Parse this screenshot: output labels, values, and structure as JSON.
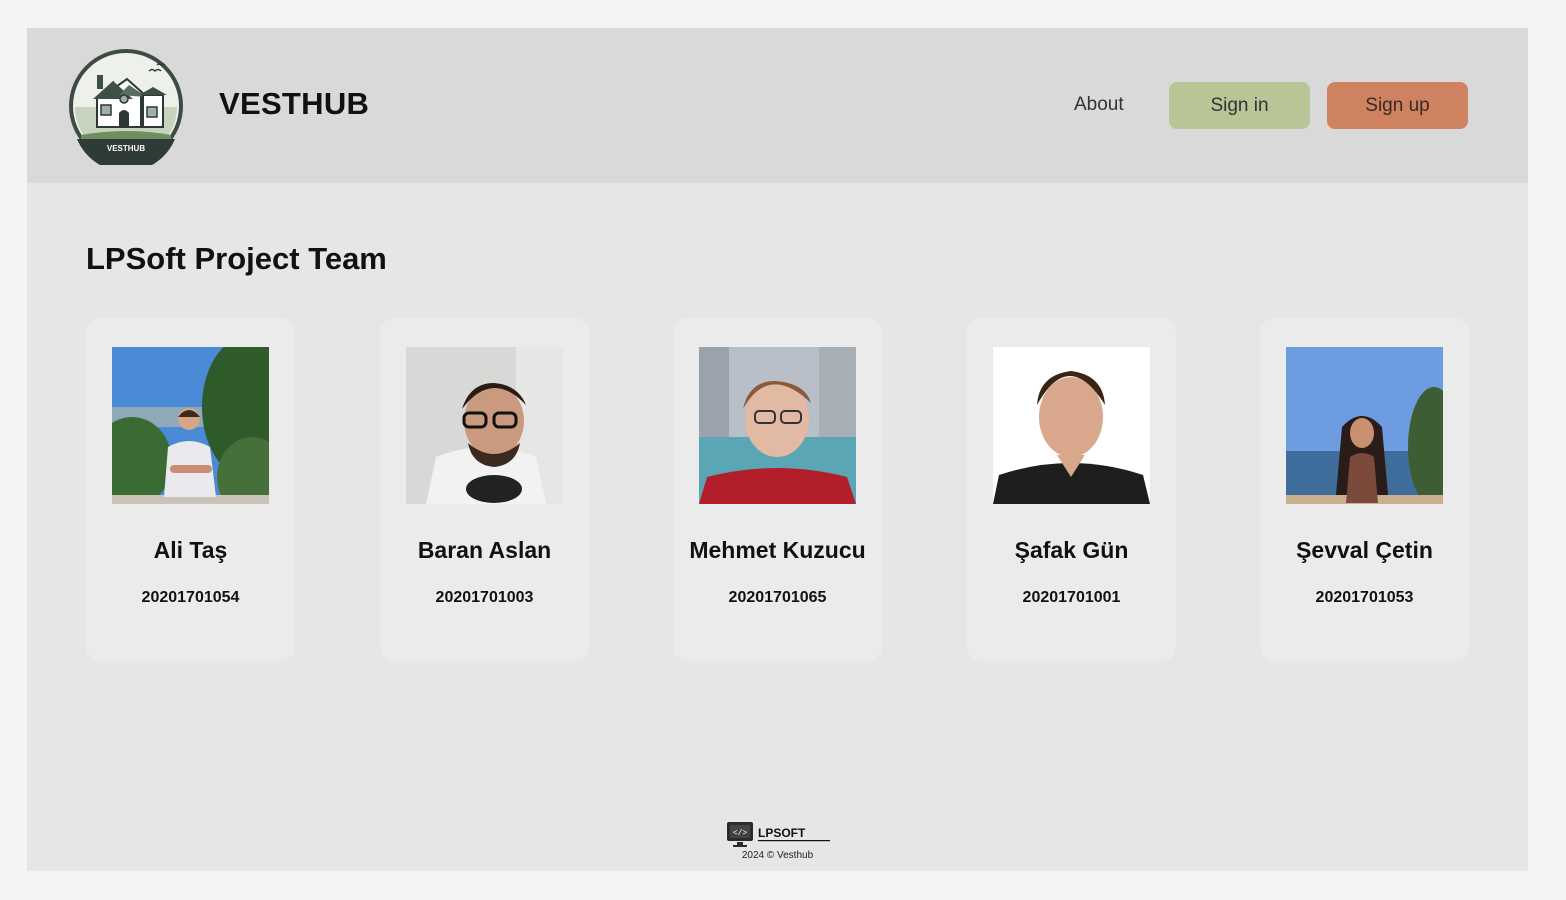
{
  "header": {
    "brand": "VESTHUB",
    "logo_caption": "VESTHUB",
    "nav_about": "About",
    "signin_label": "Sign in",
    "signup_label": "Sign up"
  },
  "main": {
    "title": "LPSoft Project Team",
    "members": [
      {
        "name": "Ali Taş",
        "id": "20201701054"
      },
      {
        "name": "Baran Aslan",
        "id": "20201701003"
      },
      {
        "name": "Mehmet Kuzucu",
        "id": "20201701065"
      },
      {
        "name": "Şafak Gün",
        "id": "20201701001"
      },
      {
        "name": "Şevval Çetin",
        "id": "20201701053"
      }
    ]
  },
  "footer": {
    "company_logo": "LPSOFT",
    "copyright": "2024 © Vesthub"
  },
  "colors": {
    "signin_bg": "#b9c497",
    "signup_bg": "#cf8260",
    "header_bg": "#d9d9d9",
    "page_bg": "#e5e6e5"
  },
  "icons": {
    "logo": "house-logo-icon",
    "footer": "code-monitor-icon"
  }
}
